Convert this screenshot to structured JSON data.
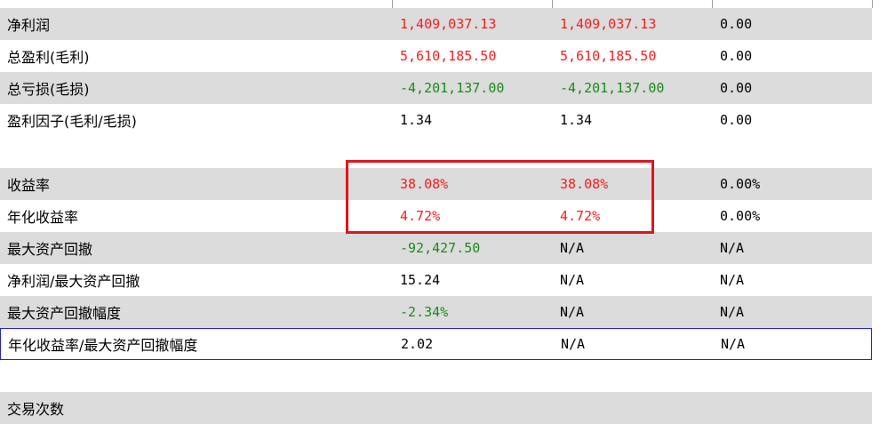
{
  "rows": [
    {
      "label": "净利润",
      "v1": "1,409,037.13",
      "v2": "1,409,037.13",
      "v3": "0.00"
    },
    {
      "label": "总盈利(毛利)",
      "v1": "5,610,185.50",
      "v2": "5,610,185.50",
      "v3": "0.00"
    },
    {
      "label": "总亏损(毛损)",
      "v1": "-4,201,137.00",
      "v2": "-4,201,137.00",
      "v3": "0.00"
    },
    {
      "label": "盈利因子(毛利/毛损)",
      "v1": "1.34",
      "v2": "1.34",
      "v3": "0.00"
    },
    {
      "label": "收益率",
      "v1": "38.08%",
      "v2": "38.08%",
      "v3": "0.00%"
    },
    {
      "label": "年化收益率",
      "v1": "4.72%",
      "v2": "4.72%",
      "v3": "0.00%"
    },
    {
      "label": "最大资产回撤",
      "v1": "-92,427.50",
      "v2": "N/A",
      "v3": "N/A"
    },
    {
      "label": "净利润/最大资产回撤",
      "v1": "15.24",
      "v2": "N/A",
      "v3": "N/A"
    },
    {
      "label": "最大资产回撤幅度",
      "v1": "-2.34%",
      "v2": "N/A",
      "v3": "N/A"
    },
    {
      "label": "年化收益率/最大资产回撤幅度",
      "v1": "2.02",
      "v2": "N/A",
      "v3": "N/A"
    }
  ],
  "partial_row_label": "交易次数",
  "colors": {
    "positive": "#ff1a1a",
    "negative": "#1a8a1a",
    "highlight_border": "#e0141e",
    "selection_border": "#2323c8",
    "row_shade": "#dcdcdc"
  }
}
